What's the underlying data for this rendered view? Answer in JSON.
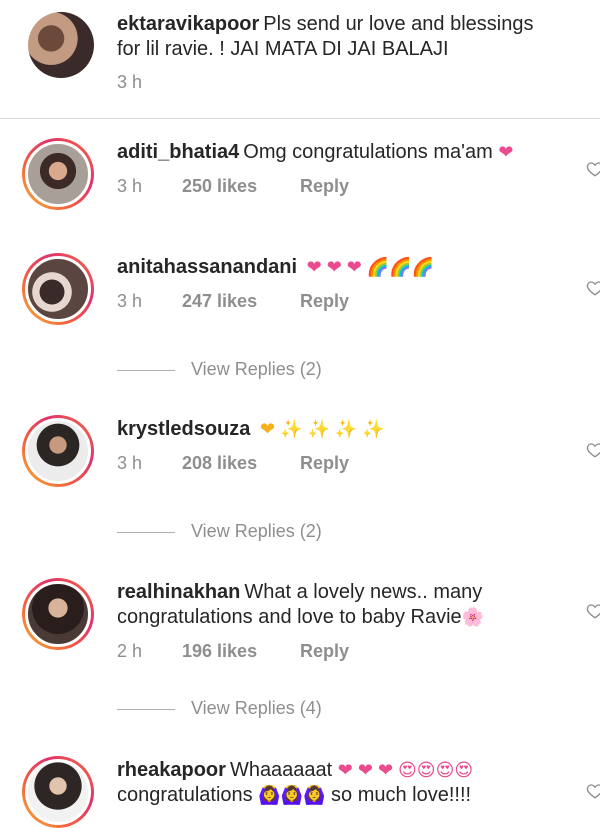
{
  "caption": {
    "username": "ektaravikapoor",
    "text": "Pls send ur love and blessings for lil ravie. ! JAI MATA DI JAI BALAJI",
    "time": "3 h"
  },
  "comments": [
    {
      "username": "aditi_bhatia4",
      "text": "Omg congratulations ma'am",
      "emoji": "❤",
      "time": "3 h",
      "likes": "250 likes",
      "reply": "Reply"
    },
    {
      "username": "anitahassanandani",
      "text": "",
      "emoji": "❤ ❤ ❤ 🌈🌈🌈",
      "time": "3 h",
      "likes": "247 likes",
      "reply": "Reply",
      "view_replies": "View Replies (2)"
    },
    {
      "username": "krystledsouza",
      "text": "",
      "emoji": "❤ ✨ ✨ ✨ ✨",
      "time": "3 h",
      "likes": "208 likes",
      "reply": "Reply",
      "view_replies": "View Replies (2)"
    },
    {
      "username": "realhinakhan",
      "text": "What a lovely news.. many congratulations and love to baby Ravie",
      "emoji": "🌸",
      "time": "2 h",
      "likes": "196 likes",
      "reply": "Reply",
      "view_replies": "View Replies (4)"
    },
    {
      "username": "rheakapoor",
      "text": "Whaaaaaat",
      "emoji": "❤ ❤ ❤ 😍😍😍😍",
      "text2": "congratulations",
      "emoji2": "🙆‍♀️🙆‍♀️🙆‍♀️",
      "text3": "so much love!!!!"
    }
  ],
  "colors": {
    "heart": "#ed4956",
    "meta": "#8e8e8e",
    "ring_start": "#f7b733",
    "ring_end": "#e1306c"
  }
}
